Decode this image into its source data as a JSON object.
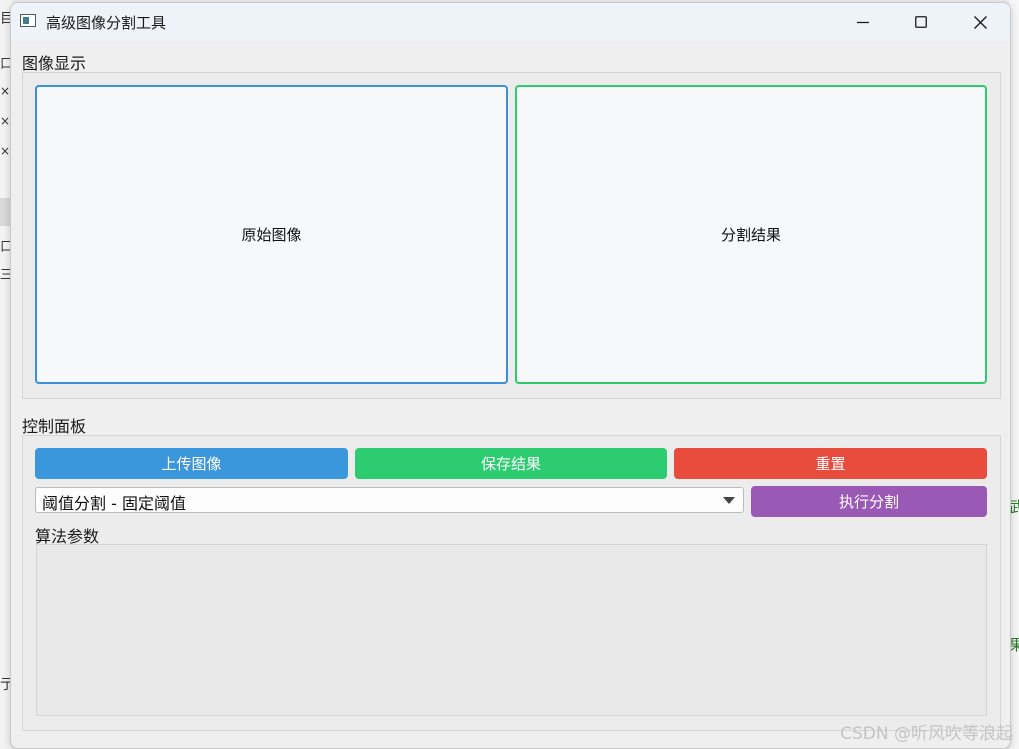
{
  "window": {
    "title": "高级图像分割工具",
    "controls": {
      "minimize_icon": "minimize-icon",
      "maximize_icon": "maximize-icon",
      "close_icon": "close-icon"
    }
  },
  "display_group": {
    "title": "图像显示",
    "original_label": "原始图像",
    "result_label": "分割结果",
    "original_border_color": "#3b8fdb",
    "result_border_color": "#2fca6e"
  },
  "control_group": {
    "title": "控制面板",
    "buttons": {
      "upload": {
        "label": "上传图像",
        "color": "#3a97db"
      },
      "save": {
        "label": "保存结果",
        "color": "#2ecc71"
      },
      "reset": {
        "label": "重置",
        "color": "#e74c3c"
      },
      "execute": {
        "label": "执行分割",
        "color": "#9b59b6"
      }
    },
    "algorithm_select": {
      "selected": "阈值分割 - 固定阈值"
    },
    "params_label": "算法参数"
  },
  "watermark": "CSDN @听风吹等浪起",
  "background_fragments": {
    "left": [
      "目",
      "口",
      "×",
      "×",
      "×",
      "口",
      "三",
      "亍"
    ],
    "right": [
      "武",
      "果"
    ]
  }
}
